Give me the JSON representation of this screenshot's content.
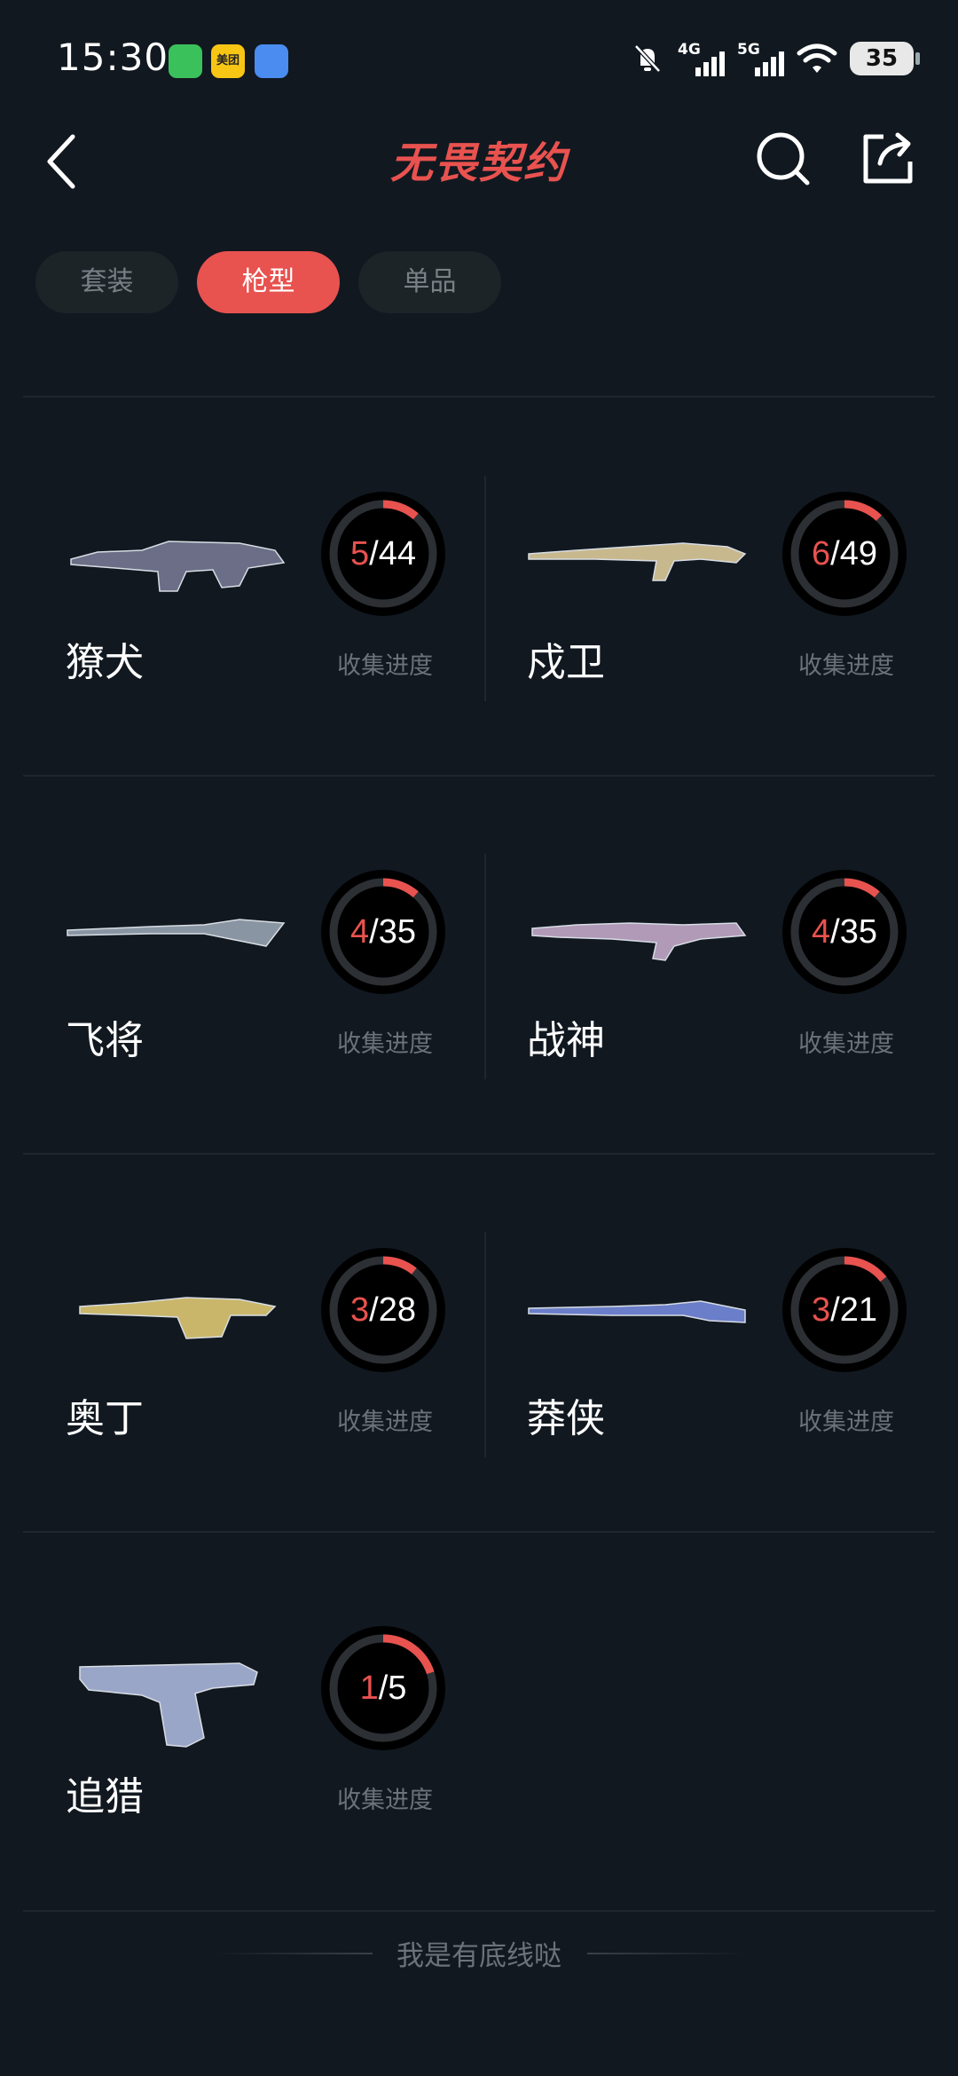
{
  "status_bar": {
    "time": "15:30",
    "meituan_badge": "美团",
    "network_1": "4G",
    "network_2": "5G",
    "battery": "35"
  },
  "nav": {
    "title": "无畏契约",
    "back_icon": "chevron-left-icon",
    "search_icon": "search-icon",
    "share_icon": "share-icon"
  },
  "tabs": [
    {
      "label": "套装",
      "active": false
    },
    {
      "label": "枪型",
      "active": true
    },
    {
      "label": "单品",
      "active": false
    }
  ],
  "weapons": [
    {
      "name": "獠犬",
      "current": "5",
      "total": "/44",
      "progress": 0.114,
      "progress_label": "收集进度",
      "color": "#6b6e86"
    },
    {
      "name": "戍卫",
      "current": "6",
      "total": "/49",
      "progress": 0.122,
      "progress_label": "收集进度",
      "color": "#c8b88e"
    },
    {
      "name": "飞将",
      "current": "4",
      "total": "/35",
      "progress": 0.114,
      "progress_label": "收集进度",
      "color": "#8a95a3"
    },
    {
      "name": "战神",
      "current": "4",
      "total": "/35",
      "progress": 0.114,
      "progress_label": "收集进度",
      "color": "#b09ab8"
    },
    {
      "name": "奥丁",
      "current": "3",
      "total": "/28",
      "progress": 0.107,
      "progress_label": "收集进度",
      "color": "#c9b66a"
    },
    {
      "name": "莽侠",
      "current": "3",
      "total": "/21",
      "progress": 0.143,
      "progress_label": "收集进度",
      "color": "#6b7ec9"
    },
    {
      "name": "追猎",
      "current": "1",
      "total": "/5",
      "progress": 0.2,
      "progress_label": "收集进度",
      "color": "#9aa6c8"
    }
  ],
  "footer": {
    "text": "我是有底线哒"
  },
  "colors": {
    "accent": "#e8524f",
    "background": "#111820",
    "ring_track": "#2c3034"
  }
}
